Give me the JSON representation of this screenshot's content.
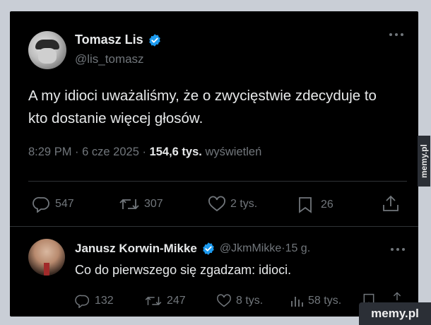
{
  "tweet": {
    "author_name": "Tomasz Lis",
    "author_handle": "@lis_tomasz",
    "text": "A my idioci uważaliśmy, że o zwycięstwie zdecyduje to kto dostanie więcej głosów.",
    "time": "8:29 PM",
    "date": "6 cze 2025",
    "views_count": "154,6 tys.",
    "views_label": "wyświetleń",
    "more_icon": "more-icon",
    "actions": {
      "replies": "547",
      "retweets": "307",
      "likes": "2 tys.",
      "bookmarks": "26"
    }
  },
  "reply": {
    "author_name": "Janusz Korwin-Mikke",
    "author_handle": "@JkmMikke",
    "age": "15 g.",
    "text": "Co do pierwszego się zgadzam: idioci.",
    "actions": {
      "replies": "132",
      "retweets": "247",
      "likes": "8 tys.",
      "views": "58 tys."
    }
  },
  "watermark": {
    "side": "memy.pl",
    "bottom": "memy.pl"
  },
  "colors": {
    "background": "#000000",
    "text": "#e7e9ea",
    "muted": "#71767b",
    "verified": "#1d9bf0",
    "divider": "#2f3336"
  }
}
